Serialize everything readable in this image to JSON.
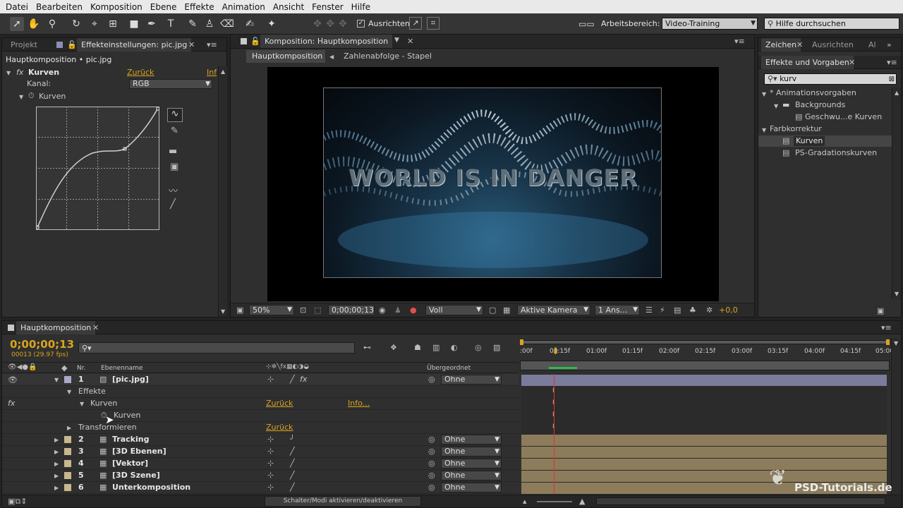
{
  "menu": [
    "Datei",
    "Bearbeiten",
    "Komposition",
    "Ebene",
    "Effekte",
    "Animation",
    "Ansicht",
    "Fenster",
    "Hilfe"
  ],
  "toolbar": {
    "align_label": "Ausrichten",
    "workspace_label": "Arbeitsbereich:",
    "workspace_value": "Video-Training",
    "help_placeholder": "Hilfe durchsuchen"
  },
  "left_panel": {
    "tab_project": "Projekt",
    "tab_effects": "Effekteinstellungen: pic.jpg",
    "path": "Hauptkomposition • pic.jpg",
    "effect_name": "Kurven",
    "reset": "Zurück",
    "info_short": "Inf",
    "channel_label": "Kanal:",
    "channel_value": "RGB",
    "curve_label": "Kurven"
  },
  "comp_panel": {
    "tab": "Komposition: Hauptkomposition",
    "crumb_main": "Hauptkomposition",
    "crumb_sub": "Zahlenabfolge - Stapel",
    "video_text": "WORLD IS IN DANGER",
    "zoom": "50%",
    "timecode": "0;00;00;13",
    "resolution": "Voll",
    "camera": "Aktive Kamera",
    "views": "1 Ans...",
    "exposure": "+0,0"
  },
  "right_panel": {
    "tabs": [
      "Zeichen",
      "Ausrichten",
      "Al"
    ],
    "effects_tab": "Effekte und Vorgaben",
    "search_value": "kurv",
    "tree": [
      {
        "label": "* Animationsvorgaben",
        "level": 0
      },
      {
        "label": "Backgrounds",
        "level": 1
      },
      {
        "label": "Geschwu...e Kurven",
        "level": 2
      },
      {
        "label": "Farbkorrektur",
        "level": 0
      },
      {
        "label": "Kurven",
        "level": 1
      },
      {
        "label": "PS-Gradationskurven",
        "level": 1
      }
    ]
  },
  "timeline": {
    "tab": "Hauptkomposition",
    "timecode": "0;00;00;13",
    "fps": "00013 (29.97 fps)",
    "col_nr": "Nr.",
    "col_name": "Ebenenname",
    "col_parent": "Übergeordnet",
    "ruler": [
      ":00f",
      "00:15f",
      "01:00f",
      "01:15f",
      "02:00f",
      "02:15f",
      "03:00f",
      "03:15f",
      "04:00f",
      "04:15f",
      "05:00"
    ],
    "sub_rows": {
      "effects": "Effekte",
      "curves": "Kurven",
      "reset": "Zurück",
      "info": "Info...",
      "curves_prop": "Kurven",
      "transform": "Transformieren",
      "transform_reset": "Zurück"
    },
    "layers": [
      {
        "nr": "1",
        "name": "[pic.jpg]",
        "parent": "Ohne"
      },
      {
        "nr": "2",
        "name": "Tracking",
        "parent": "Ohne"
      },
      {
        "nr": "3",
        "name": "[3D Ebenen]",
        "parent": "Ohne"
      },
      {
        "nr": "4",
        "name": "[Vektor]",
        "parent": "Ohne"
      },
      {
        "nr": "5",
        "name": "[3D Szene]",
        "parent": "Ohne"
      },
      {
        "nr": "6",
        "name": "Unterkomposition",
        "parent": "Ohne"
      }
    ],
    "footer_button": "Schalter/Modi aktivieren/deaktivieren"
  },
  "watermark": "PSD-Tutorials.de",
  "colors": {
    "accent": "#d9a520",
    "layer_bar": "#7b7b9b",
    "comp_bar": "#8c7c5c",
    "playhead": "#e03030"
  }
}
